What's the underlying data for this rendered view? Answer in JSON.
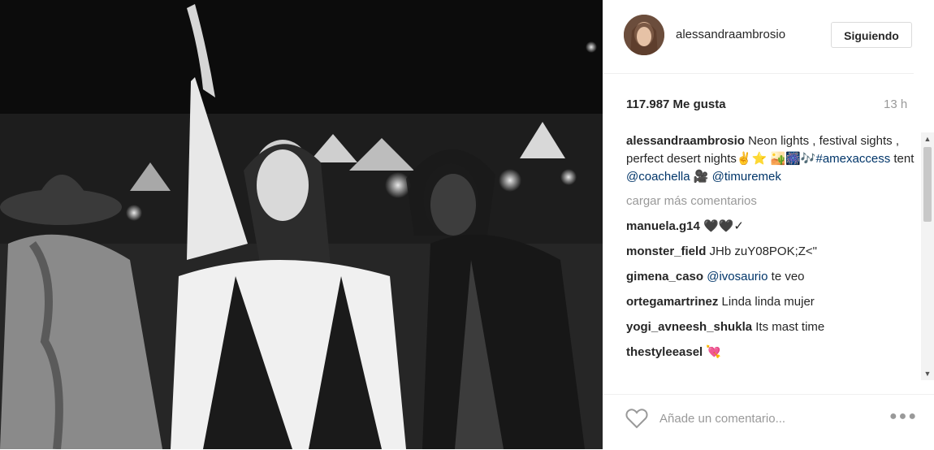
{
  "photo": {
    "alt": ""
  },
  "post": {
    "username": "alessandraambrosio",
    "follow_label": "Siguiendo",
    "likes": "117.987 Me gusta",
    "time": "13 h"
  },
  "caption": {
    "user": "alessandraambrosio",
    "text_1": " Neon lights , festival sights , perfect desert nights",
    "emoji_1": "✌️⭐",
    "emoji_2": "🏜️🎆🎶",
    "hashtag": "#amexaccess",
    "text_2": " tent ",
    "mention_1": "@coachella",
    "emoji_3": " 🎥",
    "mention_2": "@timuremek"
  },
  "load_more": "cargar más comentarios",
  "comments": [
    {
      "user": "manuela.g14",
      "text": "🖤🖤✓"
    },
    {
      "user": "monster_field",
      "text": "JHb zuY08POK;Z<\""
    },
    {
      "user": "gimena_caso",
      "mention": "@ivosaurio",
      "text": " te veo"
    },
    {
      "user": "ortegamartrinez",
      "text": "Linda linda mujer"
    },
    {
      "user": "yogi_avneesh_shukla",
      "text": "Its mast time"
    },
    {
      "user": "thestyleeasel",
      "text": "💘"
    }
  ],
  "add_comment": {
    "placeholder": "Añade un comentario..."
  },
  "icons": {
    "heart": "heart-icon",
    "more": "more-options-icon"
  },
  "colors": {
    "link": "#003569",
    "muted": "#999999",
    "text": "#262626"
  }
}
